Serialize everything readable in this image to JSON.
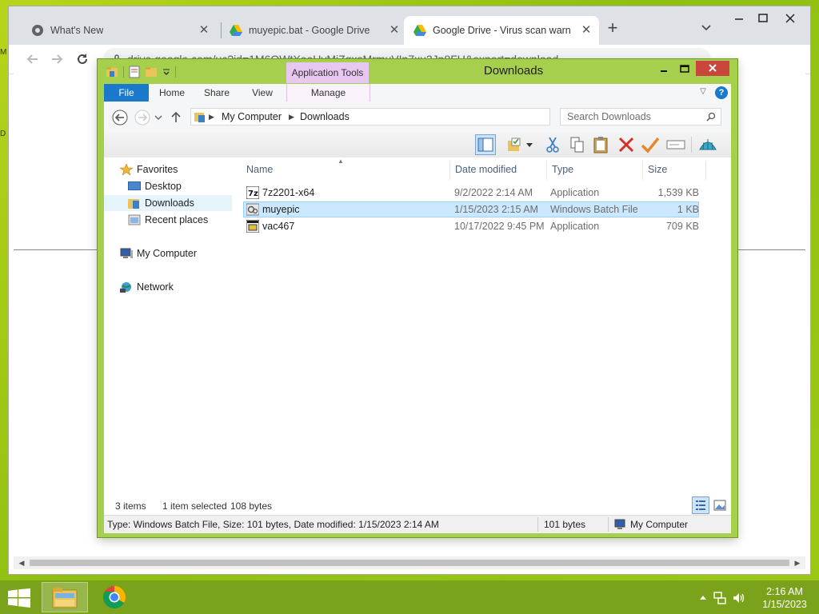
{
  "browser": {
    "tabs": [
      {
        "title": "What's New",
        "icon": "chrome-icon"
      },
      {
        "title": "muyepic.bat - Google Drive",
        "icon": "google-drive-icon"
      },
      {
        "title": "Google Drive - Virus scan warning",
        "icon": "google-drive-icon",
        "active": true
      }
    ],
    "new_tab": "+",
    "url": "drive.google.com/uc?id=1M6OWtXoeUyMjZqxsMrmuVIn7xu2Jp8FU&export=download"
  },
  "explorer": {
    "title": "Downloads",
    "context_tab": "Application Tools",
    "ribbon_tabs": {
      "file": "File",
      "home": "Home",
      "share": "Share",
      "view": "View",
      "manage": "Manage"
    },
    "breadcrumb": [
      "My Computer",
      "Downloads"
    ],
    "search_placeholder": "Search Downloads",
    "nav": {
      "favorites": "Favorites",
      "desktop": "Desktop",
      "downloads": "Downloads",
      "recent": "Recent places",
      "computer": "My Computer",
      "network": "Network"
    },
    "columns": {
      "name": "Name",
      "date": "Date modified",
      "type": "Type",
      "size": "Size"
    },
    "files": [
      {
        "name": "7z2201-x64",
        "date": "9/2/2022 2:14 AM",
        "type": "Application",
        "size": "1,539 KB"
      },
      {
        "name": "muyepic",
        "date": "1/15/2023 2:15 AM",
        "type": "Windows Batch File",
        "size": "1 KB",
        "selected": true
      },
      {
        "name": "vac467",
        "date": "10/17/2022 9:45 PM",
        "type": "Application",
        "size": "709 KB"
      }
    ],
    "status": {
      "items": "3 items",
      "selected": "1 item selected",
      "bytes": "108 bytes"
    },
    "details": {
      "info": "Type: Windows Batch File, Size: 101 bytes, Date modified: 1/15/2023 2:14 AM",
      "size": "101 bytes",
      "location": "My Computer"
    }
  },
  "taskbar": {
    "time": "2:16 AM",
    "date": "1/15/2023"
  },
  "colors": {
    "accent": "#1979ca",
    "desktop": "#a5cf4c",
    "selection": "#cce8ff",
    "close": "#c9463d"
  }
}
